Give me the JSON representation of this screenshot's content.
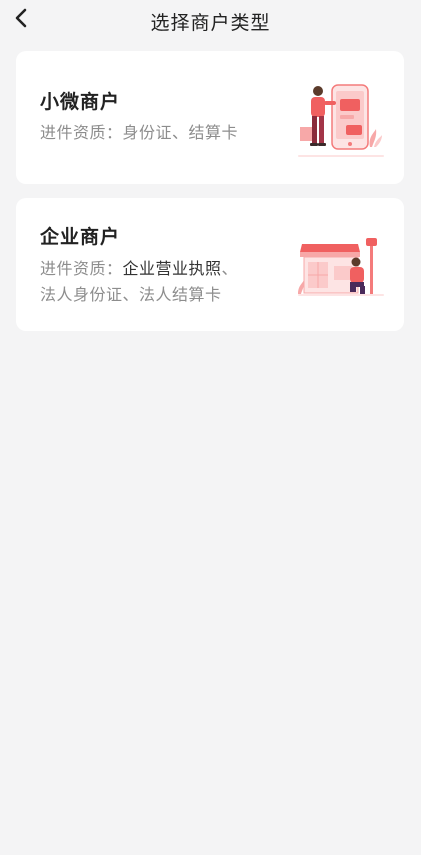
{
  "header": {
    "title": "选择商户类型"
  },
  "cards": [
    {
      "title": "小微商户",
      "desc_label": "进件资质：",
      "desc_value": "身份证、结算卡"
    },
    {
      "title": "企业商户",
      "desc_label": "进件资质：",
      "desc_value_1": "企业营业执照",
      "desc_value_2": "、",
      "desc_value_3": "法人身份证、法人结算卡"
    }
  ],
  "colors": {
    "accent": "#f06060",
    "accent_light": "#f7a8a8",
    "background": "#f4f4f5",
    "card": "#ffffff"
  },
  "icons": {
    "back": "chevron-left-icon",
    "card1_illustration": "phone-payment-illustration",
    "card2_illustration": "storefront-illustration"
  }
}
